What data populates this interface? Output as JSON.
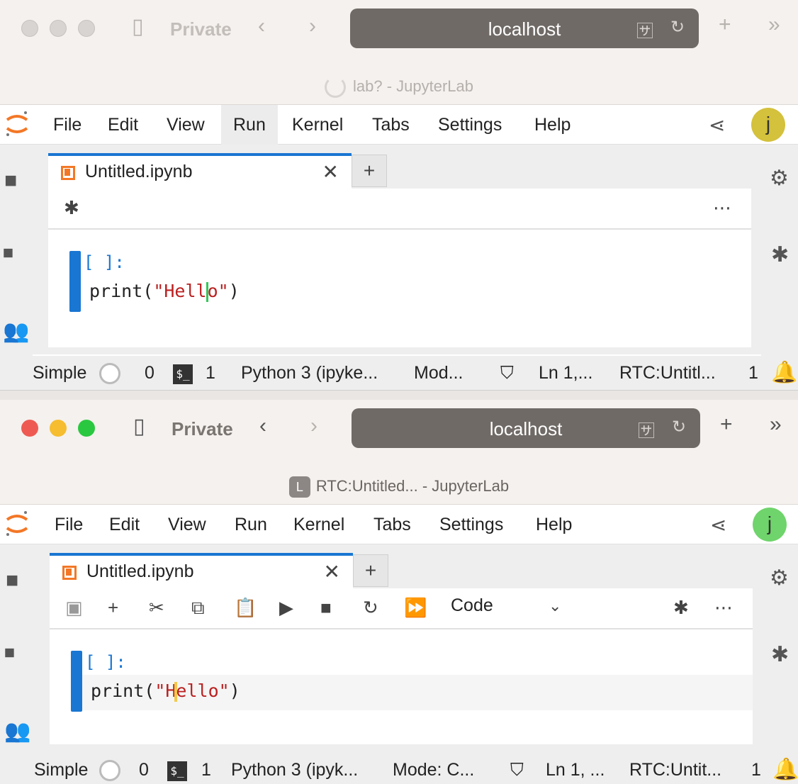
{
  "windows": [
    {
      "state": "inactive",
      "browser": {
        "private_label": "Private",
        "address": "localhost",
        "page_title": "lab? - JupyterLab"
      },
      "menu": [
        "File",
        "Edit",
        "View",
        "Run",
        "Kernel",
        "Tabs",
        "Settings",
        "Help"
      ],
      "highlighted_menu": "Run",
      "avatar": {
        "initial": "j",
        "color": "#d4c13c"
      },
      "tab": {
        "title": "Untitled.ipynb",
        "close": "✕",
        "new": "+"
      },
      "cell": {
        "prompt": "[ ]:",
        "code_prefix": "print(",
        "string_a": "\"Hell",
        "string_b": "o\"",
        "code_suffix": ")"
      },
      "status": {
        "mode": "Simple",
        "terminals": "0",
        "kernels": "1",
        "kernel": "Python 3 (ipyke...",
        "edit_mode": "Mod...",
        "position": "Ln 1,...",
        "rtc": "RTC:Untitl...",
        "notifications": "1"
      }
    },
    {
      "state": "active",
      "browser": {
        "private_label": "Private",
        "address": "localhost",
        "favicon_letter": "L",
        "page_title": "RTC:Untitled... - JupyterLab"
      },
      "menu": [
        "File",
        "Edit",
        "View",
        "Run",
        "Kernel",
        "Tabs",
        "Settings",
        "Help"
      ],
      "avatar": {
        "initial": "j",
        "color": "#6fd46b"
      },
      "tab": {
        "title": "Untitled.ipynb",
        "close": "✕",
        "new": "+"
      },
      "toolbar": {
        "cell_type": "Code"
      },
      "cell": {
        "prompt": "[ ]:",
        "code_prefix": "print(",
        "string_a": "\"H",
        "string_b": "ello\"",
        "code_suffix": ")"
      },
      "status": {
        "mode": "Simple",
        "terminals": "0",
        "kernels": "1",
        "kernel": "Python 3 (ipyk...",
        "edit_mode": "Mode: C...",
        "position": "Ln 1, ...",
        "rtc": "RTC:Untit...",
        "notifications": "1"
      }
    }
  ]
}
